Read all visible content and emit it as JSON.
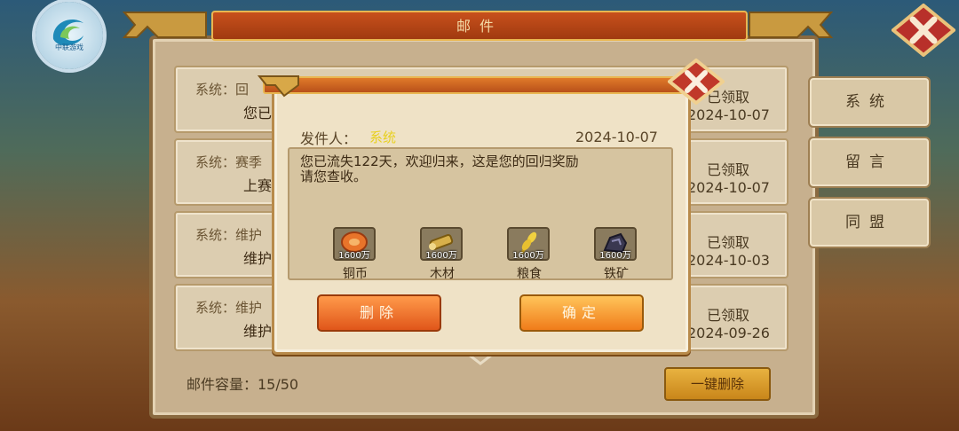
{
  "logo": {
    "text": "中联游戏"
  },
  "window": {
    "title": "邮件"
  },
  "mails": [
    {
      "from": "系统：回",
      "subject": "您已",
      "status": "已领取",
      "date": "2024-10-07"
    },
    {
      "from": "系统：赛季",
      "subject": "上赛",
      "status": "已领取",
      "date": "2024-10-07"
    },
    {
      "from": "系统：维护",
      "subject": "维护",
      "status": "已领取",
      "date": "2024-10-03"
    },
    {
      "from": "系统：维护",
      "subject": "维护",
      "status": "已领取",
      "date": "2024-09-26"
    }
  ],
  "tabs": [
    "系统",
    "留言",
    "同盟"
  ],
  "footer": {
    "capacity_label": "邮件容量：15/50",
    "delete_all": "一键删除"
  },
  "dialog": {
    "sender_label": "发件人：",
    "sender": "系统",
    "date": "2024-10-07",
    "message_line1": "您已流失122天，欢迎归来，这是您的回归奖励",
    "message_line2": "请您查收。",
    "rewards": [
      {
        "amount": "1600万",
        "name": "铜币",
        "icon": "copper-coin-icon"
      },
      {
        "amount": "1600万",
        "name": "木材",
        "icon": "wood-icon"
      },
      {
        "amount": "1600万",
        "name": "粮食",
        "icon": "grain-icon"
      },
      {
        "amount": "1600万",
        "name": "铁矿",
        "icon": "iron-ore-icon"
      }
    ],
    "delete_button": "删除",
    "confirm_button": "确定"
  },
  "colors": {
    "accent": "#e07a2a",
    "sender_highlight": "#e8d020"
  }
}
